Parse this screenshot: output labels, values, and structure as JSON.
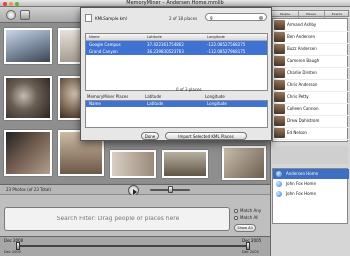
{
  "window": {
    "title": "MemoryMiner – Andersen Home.mmlib"
  },
  "dialog": {
    "file_name": "KMLSample.kml",
    "places_count": "2 of 18 places",
    "search_value": "g",
    "kml_table": {
      "headers": [
        "Name",
        "Latitude",
        "Longitude"
      ],
      "rows": [
        [
          "Google Campus",
          "37.422361754862",
          "-122.08527568275"
        ],
        [
          "Grand Canyon",
          "36.239830523763",
          "-112.08527968175"
        ]
      ]
    },
    "mm_table": {
      "headers": [
        "MemoryMiner Places",
        "Latitude",
        "Longitude"
      ],
      "count": "0 of 3 places",
      "subheaders": [
        "Name",
        "Latitude",
        "Longitude"
      ]
    },
    "done_label": "Done",
    "import_label": "Import Selected KML Places"
  },
  "people": [
    "Armand Ashby",
    "Ben Andersen",
    "Buzz Andersen",
    "Cameron Baugh",
    "Charlie Dirsten",
    "Chris Anderson",
    "Chris Petty",
    "Colleen Cannon",
    "Drew Dahlstrom",
    "Ed Nelson"
  ],
  "places": [
    {
      "name": "Andersen Home",
      "selected": true
    },
    {
      "name": "John Fox Home",
      "selected": false
    },
    {
      "name": "John Fox Home",
      "selected": false
    }
  ],
  "status": {
    "photo_count": "23 Photos (of 23 Total)"
  },
  "search": {
    "placeholder": "Search Filter: Drag people or places here",
    "option_1": "Match Any",
    "option_2": "Match All",
    "show_label": "Show All"
  },
  "timeline": {
    "start_label": "Dec 2000",
    "end_label": "Dec 2005",
    "start_sub": "Dec 2000",
    "end_sub": "Dec 2005"
  },
  "right_tabs": [
    "People",
    "Places",
    "Events"
  ]
}
